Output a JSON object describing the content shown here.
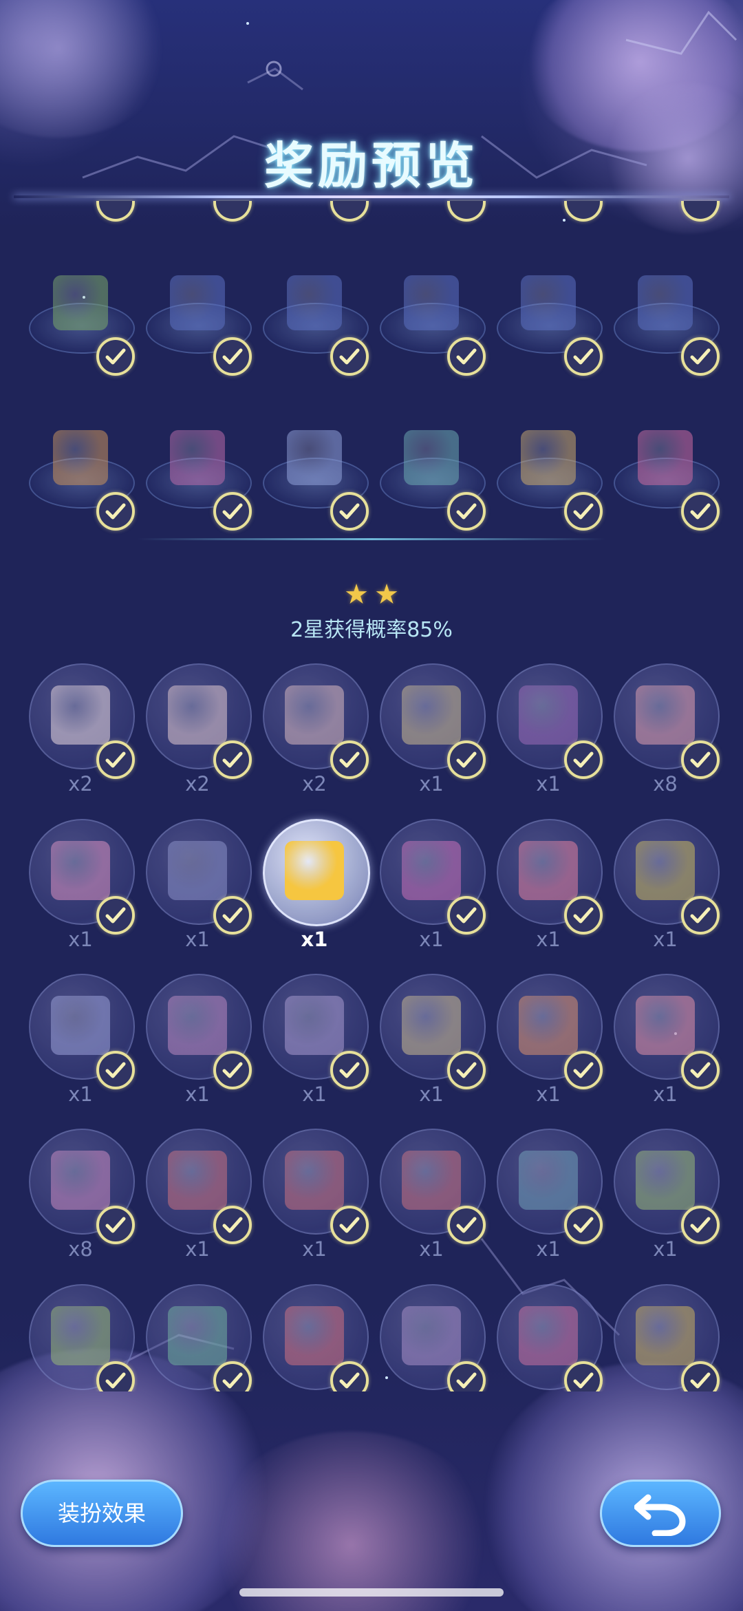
{
  "header": {
    "title": "奖励预览"
  },
  "two_star_section": {
    "stars": 2,
    "rate_label": "2星获得概率85%"
  },
  "grid_top": {
    "rows": [
      {
        "items": [
          {
            "icon": "tree-icon",
            "color": "#7aa86a"
          },
          {
            "icon": "house-icon",
            "color": "#5a6fc0"
          },
          {
            "icon": "house-icon",
            "color": "#5a6fc0"
          },
          {
            "icon": "house-icon",
            "color": "#5a6fc0"
          },
          {
            "icon": "house-icon",
            "color": "#5a6fc0"
          },
          {
            "icon": "house-icon",
            "color": "#5a6fc0"
          }
        ]
      },
      {
        "items": [
          {
            "icon": "bird-icon",
            "color": "#c9925a"
          },
          {
            "icon": "bird-icon",
            "color": "#b86aa8"
          },
          {
            "icon": "bench-icon",
            "color": "#8fa0d8"
          },
          {
            "icon": "books-icon",
            "color": "#6aa8b0"
          },
          {
            "icon": "chair-icon",
            "color": "#c8a86a"
          },
          {
            "icon": "cushion-icon",
            "color": "#c86aa0"
          }
        ]
      }
    ]
  },
  "grid_bottom": {
    "rows": [
      {
        "items": [
          {
            "icon": "bag-icon",
            "qty": "x2",
            "color": "#e8d8e0"
          },
          {
            "icon": "pouch-icon",
            "qty": "x2",
            "color": "#e0c8d0"
          },
          {
            "icon": "plant-pot-icon",
            "qty": "x2",
            "color": "#d8b8c0"
          },
          {
            "icon": "box-icon",
            "qty": "x1",
            "color": "#c8b890"
          },
          {
            "icon": "flower-badge-icon",
            "qty": "x1",
            "color": "#9a6ab8"
          },
          {
            "icon": "bottle-icon",
            "qty": "x8",
            "color": "#e0a0b0"
          }
        ]
      },
      {
        "items": [
          {
            "icon": "balloons-icon",
            "qty": "x1",
            "color": "#d890c0"
          },
          {
            "icon": "balloon-icon",
            "qty": "x1",
            "color": "#8a90c8"
          },
          {
            "icon": "duck-icon",
            "qty": "x1",
            "color": "#f6c640",
            "active": true
          },
          {
            "icon": "bunny-icon",
            "qty": "x1",
            "color": "#c870b8"
          },
          {
            "icon": "star-cushion-icon",
            "qty": "x1",
            "color": "#e080a0"
          },
          {
            "icon": "moon-icon",
            "qty": "x1",
            "color": "#c8b860"
          }
        ]
      },
      {
        "items": [
          {
            "icon": "balls-icon",
            "qty": "x1",
            "color": "#9aa0d8"
          },
          {
            "icon": "lamp-icon",
            "qty": "x1",
            "color": "#b888c0"
          },
          {
            "icon": "orb-icon",
            "qty": "x1",
            "color": "#a89ad0"
          },
          {
            "icon": "orb-icon",
            "qty": "x1",
            "color": "#c8b890"
          },
          {
            "icon": "totem-icon",
            "qty": "x1",
            "color": "#d89070"
          },
          {
            "icon": "table-icon",
            "qty": "x1",
            "color": "#e090a8"
          }
        ]
      },
      {
        "items": [
          {
            "icon": "arch-icon",
            "qty": "x8",
            "color": "#c88ac0"
          },
          {
            "icon": "sign-icon",
            "qty": "x1",
            "color": "#c87080"
          },
          {
            "icon": "sign-icon",
            "qty": "x1",
            "color": "#c87080"
          },
          {
            "icon": "sign-icon",
            "qty": "x1",
            "color": "#c87080"
          },
          {
            "icon": "tree-icon",
            "qty": "x1",
            "color": "#70a0b8"
          },
          {
            "icon": "tree-icon",
            "qty": "x1",
            "color": "#98b878"
          }
        ]
      },
      {
        "items": [
          {
            "icon": "clover-icon",
            "qty": "",
            "color": "#98b878"
          },
          {
            "icon": "vine-icon",
            "qty": "",
            "color": "#70b0a0"
          },
          {
            "icon": "flower-stem-icon",
            "qty": "",
            "color": "#d07080"
          },
          {
            "icon": "vase-icon",
            "qty": "",
            "color": "#a890c8"
          },
          {
            "icon": "flower-stem-icon",
            "qty": "",
            "color": "#c870a0"
          },
          {
            "icon": "flower-stem-icon",
            "qty": "",
            "color": "#c8b060"
          }
        ]
      }
    ]
  },
  "buttons": {
    "dress_effect_label": "装扮效果",
    "return_icon": "return-arrow-icon"
  },
  "colors": {
    "background": "#1f2459",
    "check_border": "#e7e09a",
    "button_blue": "#3f92f0",
    "title_glow": "#7fe3ff"
  }
}
